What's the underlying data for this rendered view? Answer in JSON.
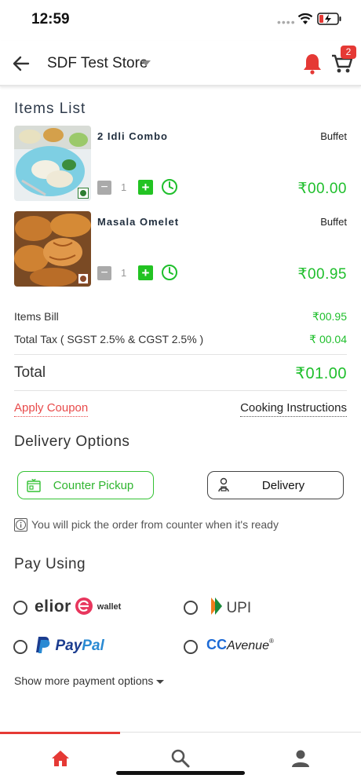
{
  "status_bar": {
    "time": "12:59"
  },
  "header": {
    "store_name": "SDF Test Store",
    "cart_count": "2"
  },
  "items_section": {
    "title": "Items List"
  },
  "items": [
    {
      "name": "2 Idli Combo",
      "tag": "Buffet",
      "qty": "1",
      "price": "₹00.00",
      "food_type": "veg"
    },
    {
      "name": "Masala Omelet",
      "tag": "Buffet",
      "qty": "1",
      "price": "₹00.95",
      "food_type": "non-veg"
    }
  ],
  "bill": {
    "items_bill_label": "Items Bill",
    "items_bill_value": "₹00.95",
    "tax_label": "Total Tax ( SGST 2.5% & CGST 2.5% )",
    "tax_value": "₹ 00.04",
    "total_label": "Total",
    "total_value": "₹01.00"
  },
  "actions": {
    "apply_coupon": "Apply Coupon",
    "cooking_instructions": "Cooking Instructions"
  },
  "delivery": {
    "title": "Delivery Options",
    "counter_pickup": "Counter Pickup",
    "delivery_label": "Delivery",
    "note": "You will pick the order from counter when it's ready"
  },
  "payment": {
    "title": "Pay Using",
    "elior_brand": "elior",
    "elior_wallet": "wallet",
    "upi": "UPI",
    "paypal_pay": "Pay",
    "paypal_pal": "Pal",
    "ccavenue_cc": "CC",
    "ccavenue_avenue": "Avenue",
    "show_more": "Show more payment options"
  },
  "colors": {
    "accent_green": "#1fbf2c",
    "accent_red": "#e53935"
  }
}
